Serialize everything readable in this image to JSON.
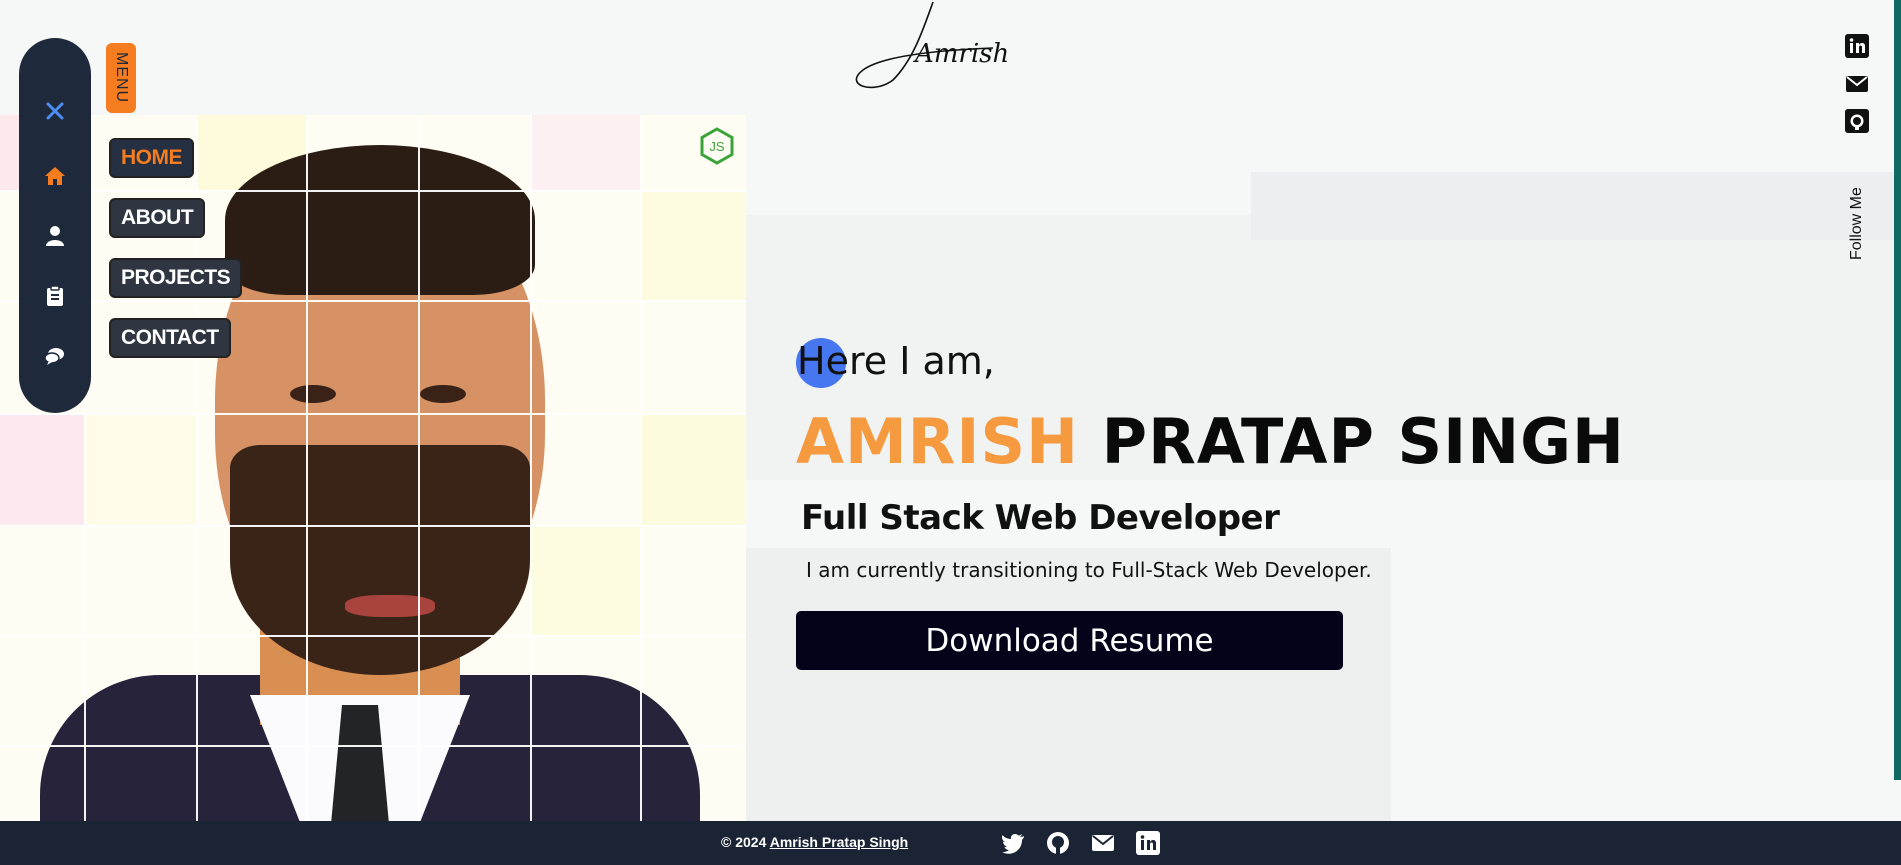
{
  "logo": {
    "text": "Amrish"
  },
  "menu_tag": "MENU",
  "sidebar": {
    "close_icon": "close-icon",
    "items": [
      {
        "icon": "home-icon"
      },
      {
        "icon": "user-icon"
      },
      {
        "icon": "clipboard-icon"
      },
      {
        "icon": "chat-icon"
      }
    ]
  },
  "nav": {
    "links": [
      {
        "label": "HOME",
        "active": true
      },
      {
        "label": "ABOUT"
      },
      {
        "label": "PROJECTS"
      },
      {
        "label": "CONTACT"
      }
    ]
  },
  "js_badge": "JS",
  "social_right": {
    "follow_label": "Follow Me",
    "icons": [
      "linkedin-icon",
      "mail-icon",
      "github-icon"
    ]
  },
  "hero": {
    "greeting": "Here I am,",
    "name_first": "AMRISH",
    "name_last": "PRATAP SINGH",
    "role": "Full Stack Web Developer",
    "description": "I am currently transitioning to Full-Stack Web Developer.",
    "cta_label": "Download Resume"
  },
  "footer": {
    "copyright_prefix": "© 2024",
    "author_link": "Amrish Pratap Singh",
    "icons": [
      "twitter-icon",
      "github-icon",
      "mail-icon",
      "linkedin-icon"
    ]
  },
  "colors": {
    "accent": "#f57c1f",
    "name_orange": "#f59a3f",
    "sidebar": "#1e2a3b",
    "button": "#04031a",
    "dot": "#4676f0"
  }
}
